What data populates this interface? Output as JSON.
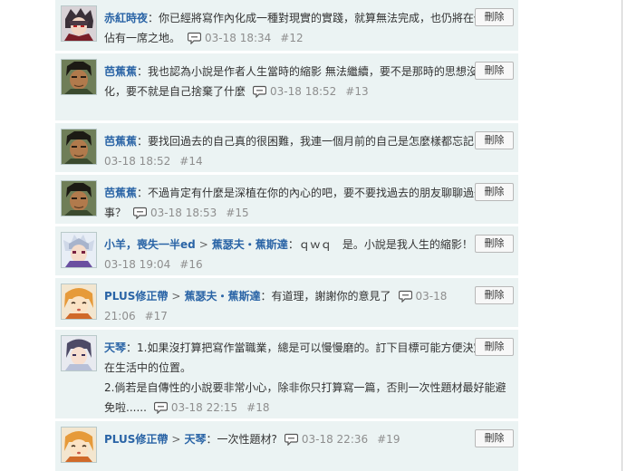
{
  "delete_label": "刪除",
  "comments": [
    {
      "user": "赤紅時夜",
      "text": "：你已經將寫作內化成一種對現實的實踐，就算無法完成，也仍將在你心中佔有一席之地。",
      "time": "03-18 18:34",
      "num": "#12"
    },
    {
      "user": "芭蕉蕉",
      "text": "：我也認為小說是作者人生當時的縮影 無法繼續，要不是那時的思想沒有被內化，要不就是自己捨棄了什麼",
      "time": "03-18 18:52",
      "num": "#13"
    },
    {
      "user": "芭蕉蕉",
      "text": "：要找回過去的自己真的很困難，我連一個月前的自己是怎麼樣都忘記了",
      "time": "03-18 18:52",
      "num": "#14"
    },
    {
      "user": "芭蕉蕉",
      "text": "：不過肯定有什麼是深植在你的內心的吧，要不要找過去的朋友聊聊過去的事？",
      "time": "03-18 18:53",
      "num": "#15"
    },
    {
      "user": "小羊，喪失一半ed",
      "reply_to": "蕉瑟夫・蕉斯達",
      "text": "：ｑｗｑ　是。小說是我人生的縮影！",
      "time": "03-18 19:04",
      "num": "#16"
    },
    {
      "user": "PLUS修正帶",
      "reply_to": "蕉瑟夫・蕉斯達",
      "text": "：有道理，謝謝你的意見了",
      "time": "03-18 21:06",
      "num": "#17"
    },
    {
      "user": "天琴",
      "text": "：1.如果沒打算把寫作當職業，總是可以慢慢磨的。訂下目標可能方便決定創作在生活中的位置。",
      "text2": "2.倘若是自傳性的小說要非常小心，除非你只打算寫一篇，否則一次性題材最好能避免啦......",
      "time": "03-18 22:15",
      "num": "#18"
    },
    {
      "user": "PLUS修正帶",
      "reply_to": "天琴",
      "text": "：一次性題材?",
      "time": "03-18 22:36",
      "num": "#19"
    }
  ]
}
